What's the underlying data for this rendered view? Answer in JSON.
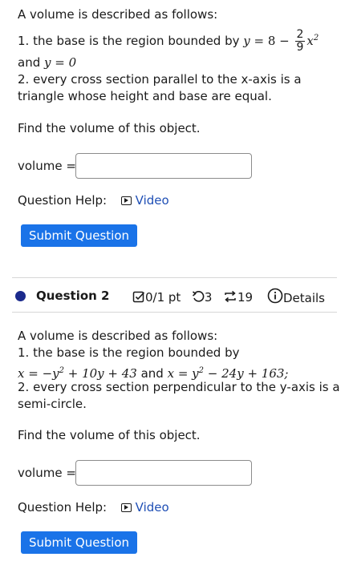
{
  "q1": {
    "intro": "A volume is described as follows:",
    "item1_prefix": "1.  the base is the region bounded by ",
    "item1_math_a": "y",
    "item1_math_b": " = 8 − ",
    "item1_frac_num": "2",
    "item1_frac_den": "9",
    "item1_math_c": "x",
    "item1_sup": "2",
    "item1_line2_text": "and ",
    "item1_line2_math": "y = 0",
    "item2_line1": "2.  every cross section parallel to the x-axis is a",
    "item2_line2": "triangle whose height and base are equal.",
    "find": "Find the volume of this object.",
    "volume_label": "volume =",
    "volume_value": "",
    "help_label": "Question Help:",
    "video_label": "Video",
    "submit_label": "Submit Question"
  },
  "q2": {
    "title": "Question 2",
    "points": "0/1 pt",
    "retries": "3",
    "attempts": "19",
    "details": "Details",
    "intro": "A volume is described as follows:",
    "item1_line1": "1.  the base is the region bounded by",
    "item1_math_a": "x = −y",
    "item1_sup_a": "2",
    "item1_math_b": " + 10y + 43",
    "item1_and": " and ",
    "item1_math_c": "x = y",
    "item1_sup_c": "2",
    "item1_math_d": " − 24y + 163;",
    "item2_line1": "2.  every cross section perpendicular to the y-axis is a",
    "item2_line2": "semi-circle.",
    "find": "Find the volume of this object.",
    "volume_label": "volume =",
    "volume_value": "",
    "help_label": "Question Help:",
    "video_label": "Video",
    "submit_label": "Submit Question"
  },
  "colors": {
    "button": "#1a73e8",
    "link": "#1f4fb5",
    "question_dot": "#1b2a8c"
  }
}
